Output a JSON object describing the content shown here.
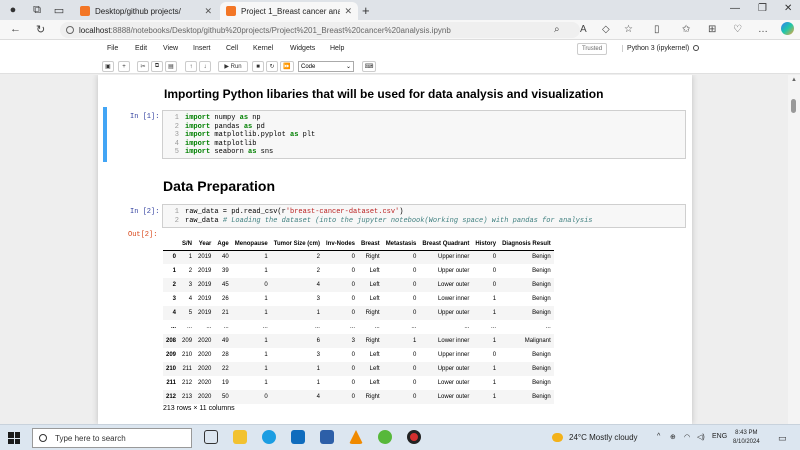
{
  "browser": {
    "tabs": [
      {
        "title": "Desktop/github projects/",
        "active": false
      },
      {
        "title": "Project 1_Breast cancer analysis",
        "active": true
      }
    ],
    "url_host": "localhost",
    "url_path": ":8888/notebooks/Desktop/github%20projects/Project%201_Breast%20cancer%20analysis.ipynb"
  },
  "jupyter": {
    "menu": [
      "File",
      "Edit",
      "View",
      "Insert",
      "Cell",
      "Kernel",
      "Widgets",
      "Help"
    ],
    "trusted_label": "Trusted",
    "kernel_label": "Python 3 (ipykernel)",
    "run_label": "Run",
    "cell_type": "Code"
  },
  "notebook": {
    "heading1": "Importing Python libaries that will be used for data analysis and visualization",
    "cell1_prompt": "In [1]:",
    "heading2": "Data Preparation",
    "cell2_prompt": "In [2]:",
    "out2_prompt": "Out[2]:",
    "shape_text": "213 rows × 11 columns"
  },
  "dataframe": {
    "columns": [
      "",
      "S/N",
      "Year",
      "Age",
      "Menopause",
      "Tumor Size (cm)",
      "Inv-Nodes",
      "Breast",
      "Metastasis",
      "Breast Quadrant",
      "History",
      "Diagnosis Result"
    ],
    "rows": [
      [
        "0",
        "1",
        "2019",
        "40",
        "1",
        "2",
        "0",
        "Right",
        "0",
        "Upper inner",
        "0",
        "Benign"
      ],
      [
        "1",
        "2",
        "2019",
        "39",
        "1",
        "2",
        "0",
        "Left",
        "0",
        "Upper outer",
        "0",
        "Benign"
      ],
      [
        "2",
        "3",
        "2019",
        "45",
        "0",
        "4",
        "0",
        "Left",
        "0",
        "Lower outer",
        "0",
        "Benign"
      ],
      [
        "3",
        "4",
        "2019",
        "26",
        "1",
        "3",
        "0",
        "Left",
        "0",
        "Lower inner",
        "1",
        "Benign"
      ],
      [
        "4",
        "5",
        "2019",
        "21",
        "1",
        "1",
        "0",
        "Right",
        "0",
        "Upper outer",
        "1",
        "Benign"
      ],
      [
        "...",
        "...",
        "...",
        "...",
        "...",
        "...",
        "...",
        "...",
        "...",
        "...",
        "...",
        "..."
      ],
      [
        "208",
        "209",
        "2020",
        "49",
        "1",
        "6",
        "3",
        "Right",
        "1",
        "Lower inner",
        "1",
        "Malignant"
      ],
      [
        "209",
        "210",
        "2020",
        "28",
        "1",
        "3",
        "0",
        "Left",
        "0",
        "Upper inner",
        "0",
        "Benign"
      ],
      [
        "210",
        "211",
        "2020",
        "22",
        "1",
        "1",
        "0",
        "Left",
        "0",
        "Upper outer",
        "1",
        "Benign"
      ],
      [
        "211",
        "212",
        "2020",
        "19",
        "1",
        "1",
        "0",
        "Left",
        "0",
        "Lower outer",
        "1",
        "Benign"
      ],
      [
        "212",
        "213",
        "2020",
        "50",
        "0",
        "4",
        "0",
        "Right",
        "0",
        "Lower outer",
        "1",
        "Benign"
      ]
    ]
  },
  "taskbar": {
    "search_placeholder": "Type here to search",
    "weather": "24°C  Mostly cloudy",
    "lang": "ENG",
    "time": "8:43 PM",
    "date": "8/10/2024"
  }
}
